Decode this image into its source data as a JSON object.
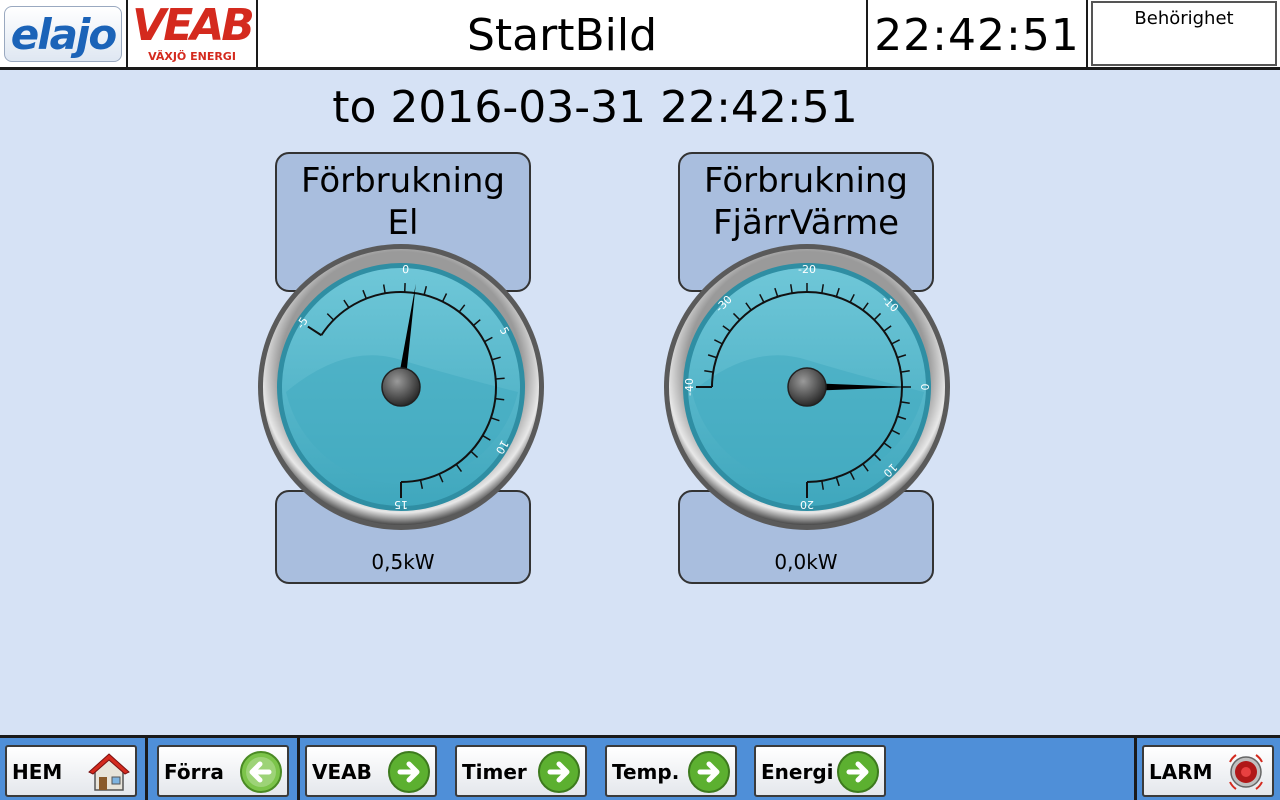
{
  "header": {
    "logo_left": "elajo",
    "logo_right": "VEAB",
    "logo_right_sub": "VÄXJÖ ENERGI",
    "title": "StartBild",
    "clock": "22:42:51",
    "auth_button": "Behörighet"
  },
  "main": {
    "datetime": "to 2016-03-31 22:42:51",
    "gauges": [
      {
        "title_line1": "Förbrukning",
        "title_line2": "El",
        "value_text": "0,5kW",
        "value": 0.5,
        "scale_min": -5,
        "scale_max": 15,
        "major_ticks": [
          "-5",
          "0",
          "5",
          "10",
          "15"
        ]
      },
      {
        "title_line1": "Förbrukning",
        "title_line2": "FjärrVärme",
        "value_text": "0,0kW",
        "value": 0.0,
        "scale_min": -40,
        "scale_max": 20,
        "major_ticks": [
          "-40",
          "-30",
          "-20",
          "-10",
          "0",
          "10",
          "20"
        ]
      }
    ]
  },
  "footer": {
    "buttons": [
      {
        "label": "HEM",
        "icon": "home-icon"
      },
      {
        "label": "Förra",
        "icon": "arrow-left-icon"
      },
      {
        "label": "VEAB",
        "icon": "arrow-right-icon"
      },
      {
        "label": "Timer",
        "icon": "arrow-right-icon"
      },
      {
        "label": "Temp.",
        "icon": "arrow-right-icon"
      },
      {
        "label": "Energi",
        "icon": "arrow-right-icon"
      },
      {
        "label": "LARM",
        "icon": "alarm-icon"
      }
    ]
  },
  "colors": {
    "background": "#d6e2f5",
    "panel": "#a9bede",
    "footer": "#4f8fd8",
    "gauge_face": "#4eb3c8",
    "veab_red": "#d42a1e",
    "elajo_blue": "#1b63b8",
    "nav_arrow_green": "#5cb030"
  }
}
